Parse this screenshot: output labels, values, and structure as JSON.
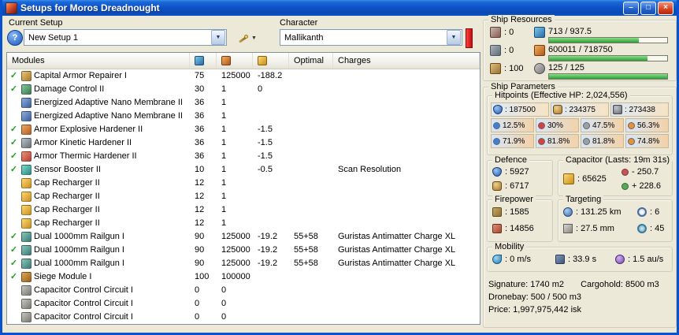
{
  "window": {
    "title": "Setups for Moros Dreadnought",
    "minimize": "–",
    "maximize": "□",
    "close": "×"
  },
  "current_setup": {
    "label": "Current Setup",
    "value": "New Setup 1",
    "help": "?"
  },
  "character": {
    "label": "Character",
    "value": "Mallikanth"
  },
  "modules_table": {
    "check_glyph": "✓",
    "header": {
      "modules": "Modules",
      "optimal": "Optimal",
      "charges": "Charges"
    },
    "rows": [
      {
        "checked": true,
        "icon": "repairer",
        "name": "Capital Armor Repairer I",
        "cpu": "75",
        "pg": "125000",
        "cap": "-188.2",
        "optimal": "",
        "charges": ""
      },
      {
        "checked": true,
        "icon": "damage-control",
        "name": "Damage Control II",
        "cpu": "30",
        "pg": "1",
        "cap": "0",
        "optimal": "",
        "charges": ""
      },
      {
        "checked": false,
        "icon": "membrane",
        "name": "Energized Adaptive Nano Membrane II",
        "cpu": "36",
        "pg": "1",
        "cap": "",
        "optimal": "",
        "charges": ""
      },
      {
        "checked": false,
        "icon": "membrane",
        "name": "Energized Adaptive Nano Membrane II",
        "cpu": "36",
        "pg": "1",
        "cap": "",
        "optimal": "",
        "charges": ""
      },
      {
        "checked": true,
        "icon": "hardener-ex",
        "name": "Armor Explosive Hardener II",
        "cpu": "36",
        "pg": "1",
        "cap": "-1.5",
        "optimal": "",
        "charges": ""
      },
      {
        "checked": true,
        "icon": "hardener-ki",
        "name": "Armor Kinetic Hardener II",
        "cpu": "36",
        "pg": "1",
        "cap": "-1.5",
        "optimal": "",
        "charges": ""
      },
      {
        "checked": true,
        "icon": "hardener-th",
        "name": "Armor Thermic Hardener II",
        "cpu": "36",
        "pg": "1",
        "cap": "-1.5",
        "optimal": "",
        "charges": ""
      },
      {
        "checked": true,
        "icon": "sensor-booster",
        "name": "Sensor Booster II",
        "cpu": "10",
        "pg": "1",
        "cap": "-0.5",
        "optimal": "",
        "charges": "Scan Resolution"
      },
      {
        "checked": false,
        "icon": "cap-recharger",
        "name": "Cap Recharger II",
        "cpu": "12",
        "pg": "1",
        "cap": "",
        "optimal": "",
        "charges": ""
      },
      {
        "checked": false,
        "icon": "cap-recharger",
        "name": "Cap Recharger II",
        "cpu": "12",
        "pg": "1",
        "cap": "",
        "optimal": "",
        "charges": ""
      },
      {
        "checked": false,
        "icon": "cap-recharger",
        "name": "Cap Recharger II",
        "cpu": "12",
        "pg": "1",
        "cap": "",
        "optimal": "",
        "charges": ""
      },
      {
        "checked": false,
        "icon": "cap-recharger",
        "name": "Cap Recharger II",
        "cpu": "12",
        "pg": "1",
        "cap": "",
        "optimal": "",
        "charges": ""
      },
      {
        "checked": true,
        "icon": "railgun",
        "name": "Dual 1000mm Railgun I",
        "cpu": "90",
        "pg": "125000",
        "cap": "-19.2",
        "optimal": "55+58",
        "charges": "Guristas Antimatter Charge XL"
      },
      {
        "checked": true,
        "icon": "railgun",
        "name": "Dual 1000mm Railgun I",
        "cpu": "90",
        "pg": "125000",
        "cap": "-19.2",
        "optimal": "55+58",
        "charges": "Guristas Antimatter Charge XL"
      },
      {
        "checked": true,
        "icon": "railgun",
        "name": "Dual 1000mm Railgun I",
        "cpu": "90",
        "pg": "125000",
        "cap": "-19.2",
        "optimal": "55+58",
        "charges": "Guristas Antimatter Charge XL"
      },
      {
        "checked": true,
        "icon": "siege",
        "name": "Siege Module I",
        "cpu": "100",
        "pg": "100000",
        "cap": "",
        "optimal": "",
        "charges": ""
      },
      {
        "checked": false,
        "icon": "rig",
        "name": "Capacitor Control Circuit I",
        "cpu": "0",
        "pg": "0",
        "cap": "",
        "optimal": "",
        "charges": ""
      },
      {
        "checked": false,
        "icon": "rig",
        "name": "Capacitor Control Circuit I",
        "cpu": "0",
        "pg": "0",
        "cap": "",
        "optimal": "",
        "charges": ""
      },
      {
        "checked": false,
        "icon": "rig",
        "name": "Capacitor Control Circuit I",
        "cpu": "0",
        "pg": "0",
        "cap": "",
        "optimal": "",
        "charges": ""
      }
    ]
  },
  "ship_resources": {
    "title": "Ship Resources",
    "turrets": ": 0",
    "launchers": ": 0",
    "calibration": ": 100",
    "cpu": {
      "value": "713 / 937.5",
      "pct": 76
    },
    "powergrid": {
      "value": "600011 / 718750",
      "pct": 83
    },
    "drone_bandwidth": {
      "value": "125 / 125",
      "pct": 100
    }
  },
  "ship_parameters": {
    "title": "Ship Parameters",
    "hitpoints": {
      "title": "Hitpoints (Effective HP: 2,024,556)",
      "shield": ": 187500",
      "armor": ": 234375",
      "structure": ": 273438",
      "resists": {
        "shield": [
          "12.5%",
          "30%",
          "47.5%",
          "56.3%"
        ],
        "armor": [
          "71.9%",
          "81.8%",
          "81.8%",
          "74.8%"
        ]
      }
    },
    "defence": {
      "title": "Defence",
      "value1": ": 5927",
      "value2": ": 6717"
    },
    "capacitor": {
      "title": "Capacitor (Lasts: 19m 31s)",
      "amount": ": 65625",
      "peak_drain": "- 250.7",
      "recharge": "+ 228.6"
    },
    "firepower": {
      "title": "Firepower",
      "dps": ": 1585",
      "volley": ": 14856"
    },
    "targeting": {
      "title": "Targeting",
      "range": ": 131.25 km",
      "max_targets": ": 6",
      "scan_resolution": ": 27.5 mm",
      "sensor_strength": ": 45"
    },
    "mobility": {
      "title": "Mobility",
      "speed": ": 0 m/s",
      "align_time": ": 33.9 s",
      "warp_speed": ": 1.5 au/s"
    },
    "footer": {
      "signature": "Signature: 1740 m2",
      "cargohold": "Cargohold: 8500 m3",
      "dronebay": "Dronebay: 500 / 500 m3",
      "price": "Price: 1,997,975,442 isk"
    }
  }
}
